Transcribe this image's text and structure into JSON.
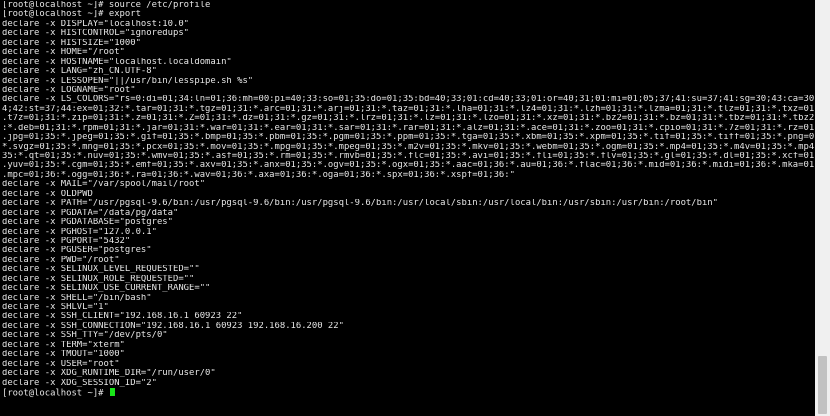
{
  "terminal": {
    "lines": [
      "[root@localhost ~]# source /etc/profile",
      "[root@localhost ~]# export",
      "declare -x DISPLAY=\"localhost:10.0\"",
      "declare -x HISTCONTROL=\"ignoredups\"",
      "declare -x HISTSIZE=\"1000\"",
      "declare -x HOME=\"/root\"",
      "declare -x HOSTNAME=\"localhost.localdomain\"",
      "declare -x LANG=\"zh_CN.UTF-8\"",
      "declare -x LESSOPEN=\"||/usr/bin/lesspipe.sh %s\"",
      "declare -x LOGNAME=\"root\"",
      "declare -x LS_COLORS=\"rs=0:di=01;34:ln=01;36:mh=00:pi=40;33:so=01;35:do=01;35:bd=40;33;01:cd=40;33;01:or=40;31;01:mi=01;05;37;41:su=37;41:sg=30;43:ca=30;41:tw=30;42:ow=3",
      "4;42:st=37;44:ex=01;32:*.tar=01;31:*.tgz=01;31:*.arc=01;31:*.arj=01;31:*.taz=01;31:*.lha=01;31:*.lz4=01;31:*.lzh=01;31:*.lzma=01;31:*.tlz=01;31:*.txz=01;31:*.tzo=01;31:*",
      ".t7z=01;31:*.zip=01;31:*.z=01;31:*.Z=01;31:*.dz=01;31:*.gz=01;31:*.lrz=01;31:*.lz=01;31:*.lzo=01;31:*.xz=01;31:*.bz2=01;31:*.bz=01;31:*.tbz=01;31:*.tbz2=01;31:*.tz=01;31",
      ":*.deb=01;31:*.rpm=01;31:*.jar=01;31:*.war=01;31:*.ear=01;31:*.sar=01;31:*.rar=01;31:*.alz=01;31:*.ace=01;31:*.zoo=01;31:*.cpio=01;31:*.7z=01;31:*.rz=01;31:*.cab=01;31:*",
      ".jpg=01;35:*.jpeg=01;35:*.gif=01;35:*.bmp=01;35:*.pbm=01;35:*.pgm=01;35:*.ppm=01;35:*.tga=01;35:*.xbm=01;35:*.xpm=01;35:*.tif=01;35:*.tiff=01;35:*.png=01;35:*.svg=01;35:",
      "*.svgz=01;35:*.mng=01;35:*.pcx=01;35:*.mov=01;35:*.mpg=01;35:*.mpeg=01;35:*.m2v=01;35:*.mkv=01;35:*.webm=01;35:*.ogm=01;35:*.mp4=01;35:*.m4v=01;35:*.mp4v=01;35:*.vob=01;",
      "35:*.qt=01;35:*.nuv=01;35:*.wmv=01;35:*.asf=01;35:*.rm=01;35:*.rmvb=01;35:*.flc=01;35:*.avi=01;35:*.fli=01;35:*.flv=01;35:*.gl=01;35:*.dl=01;35:*.xcf=01;35:*.xwd=01;35:*",
      ".yuv=01;35:*.cgm=01;35:*.emf=01;35:*.axv=01;35:*.anx=01;35:*.ogv=01;35:*.ogx=01;35:*.aac=01;36:*.au=01;36:*.flac=01;36:*.mid=01;36:*.midi=01;36:*.mka=01;36:*.mp3=01;36:*",
      ".mpc=01;36:*.ogg=01;36:*.ra=01;36:*.wav=01;36:*.axa=01;36:*.oga=01;36:*.spx=01;36:*.xspf=01;36:\"",
      "declare -x MAIL=\"/var/spool/mail/root\"",
      "declare -x OLDPWD",
      "declare -x PATH=\"/usr/pgsql-9.6/bin:/usr/pgsql-9.6/bin:/usr/pgsql-9.6/bin:/usr/local/sbin:/usr/local/bin:/usr/sbin:/usr/bin:/root/bin\"",
      "declare -x PGDATA=\"/data/pg/data\"",
      "declare -x PGDATABASE=\"postgres\"",
      "declare -x PGHOST=\"127.0.0.1\"",
      "declare -x PGPORT=\"5432\"",
      "declare -x PGUSER=\"postgres\"",
      "declare -x PWD=\"/root\"",
      "declare -x SELINUX_LEVEL_REQUESTED=\"\"",
      "declare -x SELINUX_ROLE_REQUESTED=\"\"",
      "declare -x SELINUX_USE_CURRENT_RANGE=\"\"",
      "declare -x SHELL=\"/bin/bash\"",
      "declare -x SHLVL=\"1\"",
      "declare -x SSH_CLIENT=\"192.168.16.1 60923 22\"",
      "declare -x SSH_CONNECTION=\"192.168.16.1 60923 192.168.16.200 22\"",
      "declare -x SSH_TTY=\"/dev/pts/0\"",
      "declare -x TERM=\"xterm\"",
      "declare -x TMOUT=\"1000\"",
      "declare -x USER=\"root\"",
      "declare -x XDG_RUNTIME_DIR=\"/run/user/0\"",
      "declare -x XDG_SESSION_ID=\"2\""
    ],
    "prompt": "[root@localhost ~]# ",
    "text_color": "#e6e6e6",
    "background_color": "#000000",
    "cursor_color": "#19e619"
  }
}
